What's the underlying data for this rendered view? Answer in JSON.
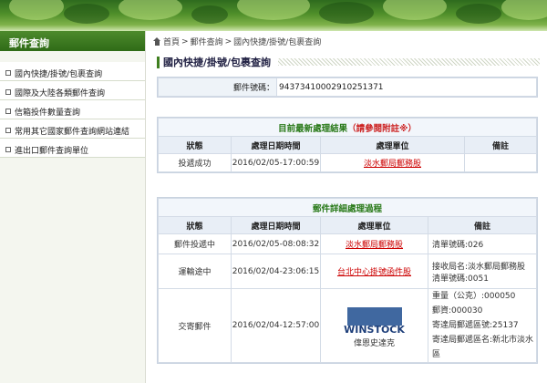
{
  "sidebar": {
    "title": "郵件查詢",
    "items": [
      {
        "label": "國內快捷/掛號/包裹查詢"
      },
      {
        "label": "國際及大陸各類郵件查詢"
      },
      {
        "label": "信箱投件數量查詢"
      },
      {
        "label": "常用其它國家郵件查詢網站連結"
      },
      {
        "label": "進出口郵件查詢單位"
      }
    ]
  },
  "breadcrumb": {
    "home": "首頁",
    "sep1": ">",
    "level1": "郵件查詢",
    "sep2": ">",
    "level2": "國內快捷/掛號/包裹查詢"
  },
  "page_title": "國內快捷/掛號/包裹查詢",
  "mail": {
    "label": "郵件號碼：",
    "number": "94373410002910251371"
  },
  "latest": {
    "title": "目前最新處理結果",
    "note": "（請參閱附註※）",
    "headers": [
      "狀態",
      "處理日期時間",
      "處理單位",
      "備註"
    ],
    "row": {
      "status": "投遞成功",
      "datetime": "2016/02/05-17:00:59",
      "unit": "淡水郵局郵務股",
      "remark": ""
    }
  },
  "details": {
    "title": "郵件詳細處理過程",
    "headers": [
      "狀態",
      "處理日期時間",
      "處理單位",
      "備註"
    ],
    "rows": [
      {
        "status": "郵件投遞中",
        "datetime": "2016/02/05-08:08:32",
        "unit": "淡水郵局郵務股",
        "remark1": "清單號碼:026",
        "remark2": ""
      },
      {
        "status": "運輸途中",
        "datetime": "2016/02/04-23:06:15",
        "unit": "台北中心掛號函件股",
        "remark1": "接收局名:淡水郵局郵務股",
        "remark2": "清單號碼:0051"
      },
      {
        "status": "交寄郵件",
        "datetime": "2016/02/04-12:57:00",
        "unit": "",
        "remark1": "重量（公克）:000050",
        "remark2": "郵資:000030",
        "remark3": "寄達局郵遞區號:25137",
        "remark4": "寄達局郵遞區名:新北市淡水區"
      }
    ]
  },
  "watermark": {
    "brand": "WINSTOCK",
    "sub": "偉恩史達克"
  }
}
